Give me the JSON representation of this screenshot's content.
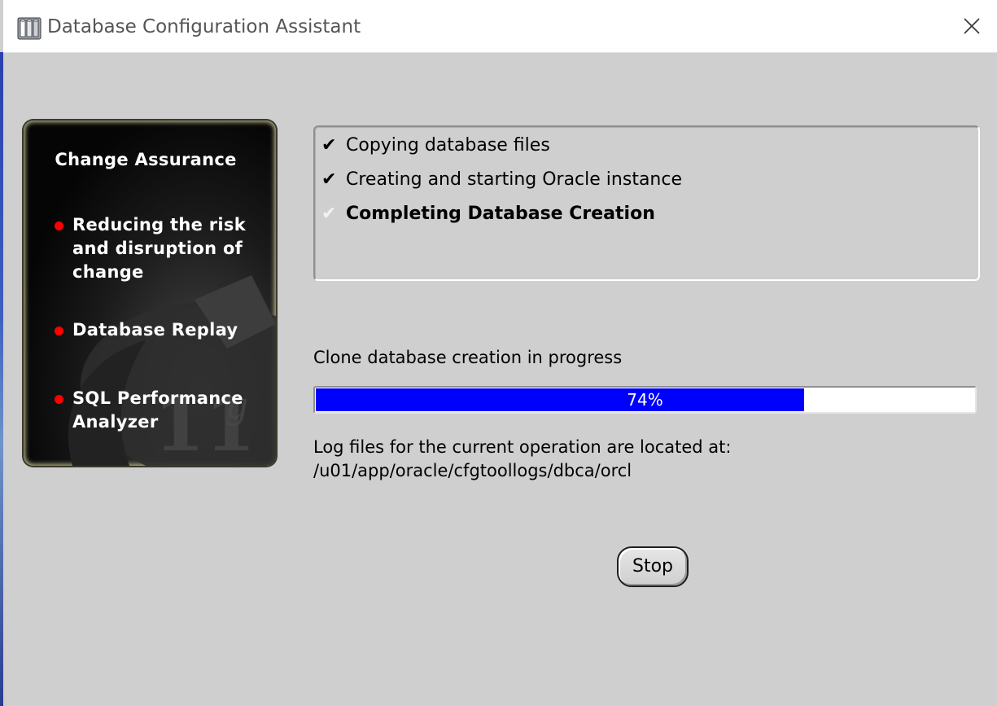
{
  "window": {
    "title": "Database Configuration Assistant"
  },
  "promo": {
    "heading": "Change Assurance",
    "bullets": [
      {
        "line1": "Reducing the risk",
        "line2": "and disruption of",
        "line3": "change"
      },
      {
        "line1": "Database Replay"
      },
      {
        "line1": "SQL Performance",
        "line2": "Analyzer"
      }
    ],
    "logo_text": "11g"
  },
  "steps": [
    {
      "label": "Copying database files",
      "status": "done",
      "check": "✔"
    },
    {
      "label": "Creating and starting Oracle instance",
      "status": "done",
      "check": "✔"
    },
    {
      "label": "Completing Database Creation",
      "status": "in-progress",
      "check": "✔"
    }
  ],
  "status": {
    "text": "Clone database creation in progress"
  },
  "progress": {
    "value": 0.74,
    "label": "74%"
  },
  "log": {
    "line1": "Log files for the current operation are located at:",
    "path": "/u01/app/oracle/cfgtoollogs/dbca/orcl"
  },
  "buttons": {
    "stop": "Stop"
  },
  "colors": {
    "progress_fill": "#0000ff",
    "bullet_dot": "#ff0000",
    "window_bg": "#cfcfcf"
  },
  "icons": {
    "app": "database-app-icon",
    "close": "close-icon"
  }
}
